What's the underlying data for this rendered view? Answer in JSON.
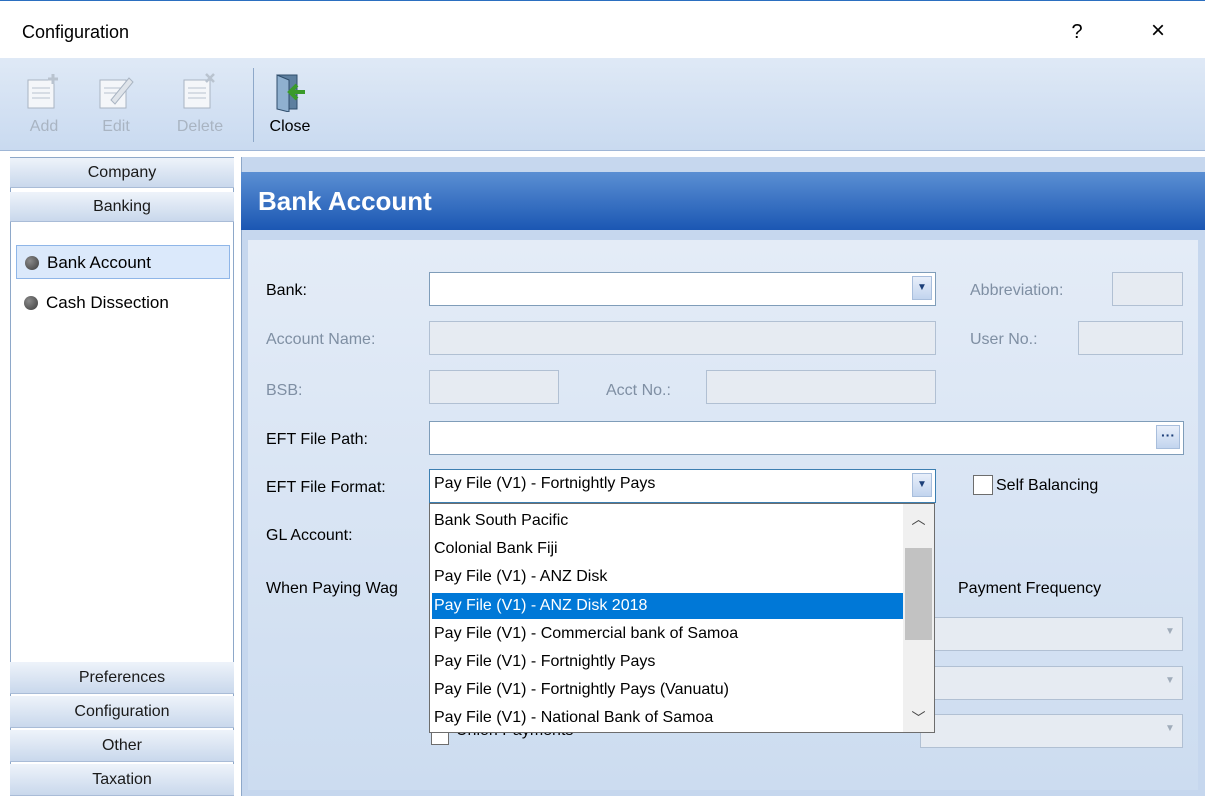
{
  "window": {
    "title": "Configuration",
    "help": "?",
    "close": "×"
  },
  "toolbar": {
    "add_label": "Add",
    "edit_label": "Edit",
    "delete_label": "Delete",
    "close_label": "Close"
  },
  "nav": {
    "groups_top": [
      "Company",
      "Banking"
    ],
    "items": [
      {
        "label": "Bank Account",
        "selected": true
      },
      {
        "label": "Cash Dissection",
        "selected": false
      }
    ],
    "groups_bottom": [
      "Preferences",
      "Configuration",
      "Other",
      "Taxation"
    ]
  },
  "page": {
    "title": "Bank Account"
  },
  "form": {
    "bank_label": "Bank:",
    "bank_value": "",
    "abbreviation_label": "Abbreviation:",
    "account_name_label": "Account Name:",
    "user_no_label": "User No.:",
    "bsb_label": "BSB:",
    "acct_no_label": "Acct No.:",
    "eft_path_label": "EFT File Path:",
    "eft_path_button": "···",
    "eft_format_label": "EFT File Format:",
    "eft_format_value": "Pay File (V1) - Fortnightly Pays",
    "self_balancing_label": "Self Balancing",
    "self_balancing_checked": false,
    "gl_account_label": "GL Account:",
    "when_paying_label": "When Paying Wag",
    "payment_frequency_label": "Payment Frequency",
    "union_payments_label": "Union Payments"
  },
  "dropdown": {
    "items": [
      "Bank South Pacific",
      "Colonial Bank Fiji",
      "Pay File (V1) - ANZ Disk",
      "Pay File (V1) - ANZ Disk 2018",
      "Pay File (V1) - Commercial bank of Samoa",
      "Pay File (V1) - Fortnightly Pays",
      "Pay File (V1) - Fortnightly Pays (Vanuatu)",
      "Pay File (V1) - National Bank of Samoa"
    ],
    "selected_index": 3
  },
  "colors": {
    "accent": "#1b57b3",
    "selection": "#0078d7"
  }
}
